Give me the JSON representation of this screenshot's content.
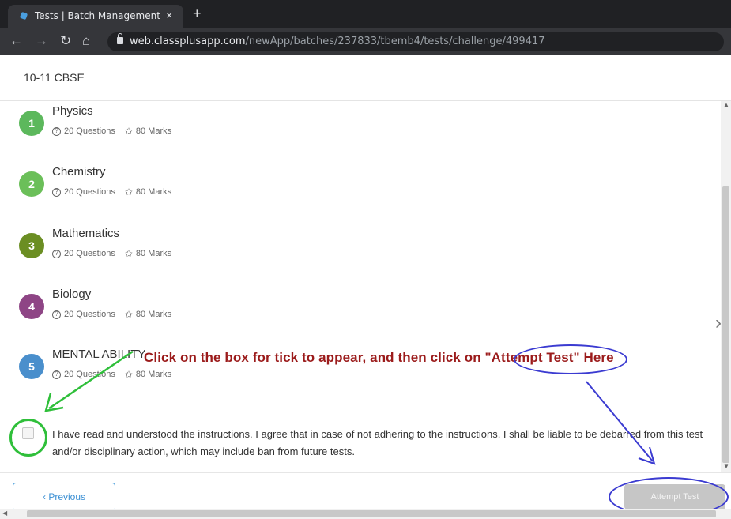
{
  "browser": {
    "tab_title": "Tests | Batch Management",
    "tab_close": "×",
    "new_tab": "+",
    "url_host": "web.classplusapp.com",
    "url_path": "/newApp/batches/237833/tbemb4/tests/challenge/499417"
  },
  "header": {
    "batch_title": "10-11 CBSE"
  },
  "subjects": [
    {
      "number": "1",
      "name": "Physics",
      "questions": "20 Questions",
      "marks": "80 Marks",
      "color": "#5cb85c"
    },
    {
      "number": "2",
      "name": "Chemistry",
      "questions": "20 Questions",
      "marks": "80 Marks",
      "color": "#6bbf59"
    },
    {
      "number": "3",
      "name": "Mathematics",
      "questions": "20 Questions",
      "marks": "80 Marks",
      "color": "#6b8e23"
    },
    {
      "number": "4",
      "name": "Biology",
      "questions": "20 Questions",
      "marks": "80 Marks",
      "color": "#8e4585"
    },
    {
      "number": "5",
      "name": "MENTAL ABILITY",
      "questions": "20 Questions",
      "marks": "80 Marks",
      "color": "#4a8fcc"
    }
  ],
  "annotation": {
    "text": "Click on the box for tick to appear, and then click on \"Attempt Test\" Here",
    "color": "#9b1b1b"
  },
  "agreement": {
    "text": "I have read and understood the instructions. I agree that in case of not adhering to the instructions, I shall be liable to be debarred from this test and/or disciplinary action, which may include ban from future tests.",
    "checked": false
  },
  "footer": {
    "previous_label": "‹ Previous",
    "attempt_label": "Attempt Test",
    "attempt_enabled": false
  },
  "icons": {
    "back": "back-arrow-icon",
    "forward": "forward-arrow-icon",
    "reload": "reload-icon",
    "home": "home-icon",
    "lock": "lock-icon",
    "questions": "question-circle-icon",
    "marks": "star-icon",
    "next": "chevron-right-icon"
  }
}
